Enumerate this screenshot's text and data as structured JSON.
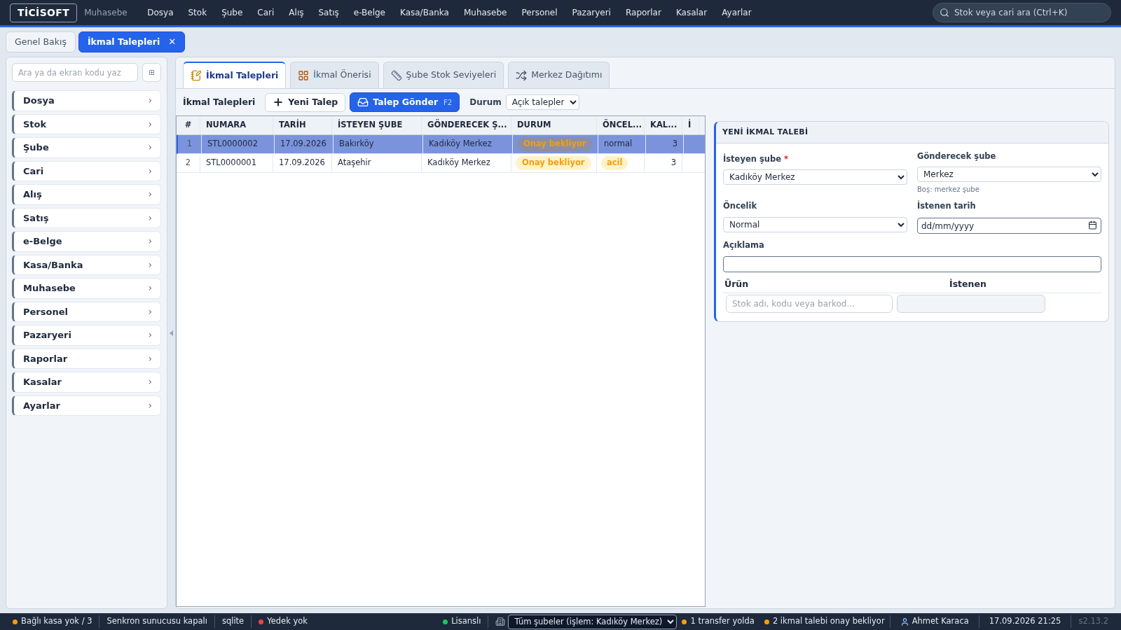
{
  "topbar": {
    "logo": "TİCİSOFT",
    "module": "Muhasebe",
    "menu": [
      "Dosya",
      "Stok",
      "Şube",
      "Cari",
      "Alış",
      "Satış",
      "e-Belge",
      "Kasa/Banka",
      "Muhasebe",
      "Personel",
      "Pazaryeri",
      "Raporlar",
      "Kasalar",
      "Ayarlar"
    ],
    "search": {
      "placeholder": "Stok veya cari ara (Ctrl+K)"
    }
  },
  "page_tabs": [
    {
      "label": "Genel Bakış",
      "selected": false,
      "closable": false
    },
    {
      "label": "İkmal Talepleri",
      "selected": true,
      "closable": true
    }
  ],
  "close_glyph": "✕",
  "sidebar": {
    "search": {
      "placeholder": "Ara ya da ekran kodu yaz"
    },
    "grid_glyph": "⊞",
    "chevron": "›",
    "items": [
      "Dosya",
      "Stok",
      "Şube",
      "Cari",
      "Alış",
      "Satış",
      "e-Belge",
      "Kasa/Banka",
      "Muhasebe",
      "Personel",
      "Pazaryeri",
      "Raporlar",
      "Kasalar",
      "Ayarlar"
    ]
  },
  "content_tabs": [
    {
      "label": "İkmal Talepleri",
      "selected": true
    },
    {
      "label": "İkmal Önerisi",
      "selected": false
    },
    {
      "label": "Şube Stok Seviyeleri",
      "selected": false
    },
    {
      "label": "Merkez Dağıtımı",
      "selected": false
    }
  ],
  "toolbar": {
    "title": "İkmal Talepleri",
    "new_button": "Yeni Talep",
    "send_button": {
      "label": "Talep Gönder",
      "shortcut": "F2"
    },
    "status_label": "Durum",
    "status_value": "Açık talepler"
  },
  "table": {
    "columns": [
      "#",
      "NUMARA",
      "TARİH",
      "İSTEYEN ŞUBE",
      "GÖNDERECEK Ş...",
      "DURUM",
      "ÖNCEL...",
      "KAL...",
      "İ"
    ],
    "rows": [
      {
        "index": "1",
        "number": "STL0000002",
        "date": "17.09.2026",
        "requester": "Bakırköy",
        "sender": "Kadıköy Merkez",
        "status": "Onay bekliyor",
        "priority": {
          "text": "normal",
          "kind": "plain"
        },
        "remaining": "3",
        "selected": true
      },
      {
        "index": "2",
        "number": "STL0000001",
        "date": "17.09.2026",
        "requester": "Ataşehir",
        "sender": "Kadıköy Merkez",
        "status": "Onay bekliyor",
        "priority": {
          "text": "acil",
          "kind": "badge"
        },
        "remaining": "3",
        "selected": false
      }
    ]
  },
  "form": {
    "title": "YENİ İKMAL TALEBİ",
    "requester": {
      "label": "İsteyen şube",
      "required_mark": "*",
      "value": "Kadıköy Merkez"
    },
    "sender": {
      "label": "Gönderecek şube",
      "value": "Merkez",
      "hint": "Boş: merkez şube"
    },
    "priority": {
      "label": "Öncelik",
      "value": "Normal"
    },
    "date": {
      "label": "İstenen tarih",
      "placeholder": "dd/mm/yyyy"
    },
    "description": {
      "label": "Açıklama"
    },
    "lines": {
      "columns": [
        "Ürün",
        "İstenen"
      ],
      "product_placeholder": "Stok adı, kodu veya barkod..."
    }
  },
  "status_bar": {
    "left": [
      {
        "text": "Bağlı kasa yok / 3",
        "color": "#f59e0b"
      },
      {
        "text": "Senkron sunucusu kapalı"
      },
      {
        "text": "sqlite"
      },
      {
        "text": "Yedek yok",
        "color": "#ef4444"
      }
    ],
    "license": {
      "text": "Lisanslı",
      "color": "#22c55e"
    },
    "branch_select": "Tüm şubeler (işlem: Kadıköy Merkez)",
    "alerts": [
      {
        "text": "1 transfer yolda",
        "color": "#f59e0b"
      },
      {
        "text": "2 ikmal talebi onay bekliyor",
        "color": "#f59e0b"
      }
    ],
    "user": "Ahmet Karaca",
    "datetime": "17.09.2026 21:25",
    "version": "s2.13.2"
  }
}
